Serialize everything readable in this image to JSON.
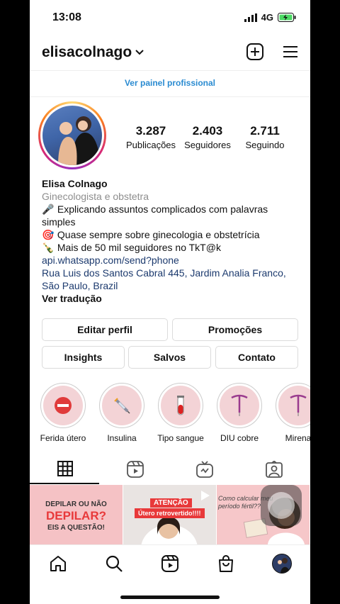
{
  "status_bar": {
    "time": "13:08",
    "network": "4G"
  },
  "header": {
    "username": "elisacolnago",
    "chevron_icon": "chevron-down-icon",
    "new_post_icon": "plus-square-icon",
    "menu_icon": "hamburger-menu-icon"
  },
  "pro_panel_link": "Ver painel profissional",
  "stats": [
    {
      "value": "3.287",
      "label": "Publicações"
    },
    {
      "value": "2.403",
      "label": "Seguidores"
    },
    {
      "value": "2.711",
      "label": "Seguindo"
    }
  ],
  "bio": {
    "name": "Elisa Colnago",
    "category": "Ginecologista e obstetra",
    "line1_emoji": "🎤",
    "line1": "Explicando assuntos complicados com palavras",
    "line1b": "simples",
    "line2_emoji": "🎯",
    "line2": "Quase sempre sobre ginecologia e obstetrícia",
    "line3_emoji": "🍾",
    "line3": "Mais de 50 mil seguidores no TkT@k",
    "link": "api.whatsapp.com/send?phone",
    "address1": "Rua Luis dos Santos Cabral 445, Jardim Analia Franco,",
    "address2": "São Paulo, Brazil",
    "translate": "Ver tradução"
  },
  "buttons": {
    "edit_profile": "Editar perfil",
    "promotions": "Promoções",
    "insights": "Insights",
    "saved": "Salvos",
    "contact": "Contato"
  },
  "highlights": [
    {
      "label": "Ferida útero",
      "icon": "no-entry-icon"
    },
    {
      "label": "Insulina",
      "icon": "syringe-icon"
    },
    {
      "label": "Tipo sangue",
      "icon": "test-tube-icon"
    },
    {
      "label": "DIU cobre",
      "icon": "iud-icon"
    },
    {
      "label": "Mirena",
      "icon": "iud-icon"
    }
  ],
  "tabs": [
    "grid-icon",
    "reels-icon",
    "igtv-icon",
    "tagged-icon"
  ],
  "posts": [
    {
      "line1": "DEPILAR OU NÃO",
      "line2": "DEPILAR?",
      "line3": "EIS A QUESTÃO!"
    },
    {
      "tag": "ATENÇÃO",
      "caption": "Útero retrovertido!!!!"
    },
    {
      "text": "Como calcular meu período fértil??"
    }
  ],
  "bottom_nav": [
    "home-icon",
    "search-icon",
    "reels-icon",
    "shop-icon",
    "profile-avatar"
  ],
  "colors": {
    "link_blue": "#2a8bd1",
    "bio_link": "#1c3a6e",
    "highlight_bg": "#f3d3d6",
    "post_pink": "#f5c2c5",
    "alert_red": "#e8393a"
  }
}
